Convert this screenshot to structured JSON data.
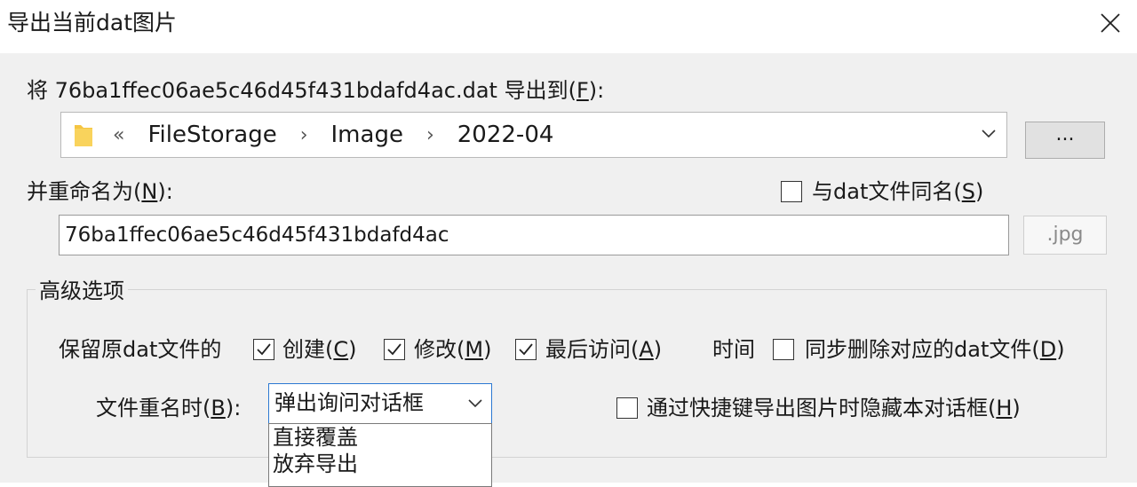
{
  "window": {
    "title": "导出当前dat图片"
  },
  "export": {
    "prefix": "将",
    "filename": "76ba1ffec06ae5c46d45f431bdafd4ac.dat",
    "suffix": "导出到(",
    "hotkey": "F",
    "suffix_end": "):"
  },
  "path": {
    "overflow": "«",
    "crumbs": [
      "FileStorage",
      "Image",
      "2022-04"
    ],
    "sep": "›"
  },
  "browse_label": "...",
  "rename": {
    "label": "并重命名为(",
    "hotkey": "N",
    "label_end": "):",
    "value": "76ba1ffec06ae5c46d45f431bdafd4ac",
    "extension": ".jpg",
    "same_name_label": "与dat文件同名(",
    "same_name_hotkey": "S",
    "same_name_end": ")"
  },
  "advanced": {
    "title": "高级选项",
    "keep_label": "保留原dat文件的",
    "created_label": "创建(",
    "created_hotkey": "C",
    "modified_label": "修改(",
    "modified_hotkey": "M",
    "accessed_label": "最后访问(",
    "accessed_hotkey": "A",
    "close_paren": ")",
    "time_label": "时间",
    "sync_delete_label": "同步删除对应的dat文件(",
    "sync_delete_hotkey": "D",
    "on_rename_label": "文件重名时(",
    "on_rename_hotkey": "B",
    "on_rename_end": "):",
    "on_rename_selected": "弹出询问对话框",
    "on_rename_options": [
      "直接覆盖",
      "放弃导出"
    ],
    "hide_dialog_label": "通过快捷键导出图片时隐藏本对话框(",
    "hide_dialog_hotkey": "H"
  },
  "checkboxes": {
    "same_name": false,
    "created": true,
    "modified": true,
    "accessed": true,
    "sync_delete": false,
    "hide_dialog": false
  },
  "colors": {
    "dialog_bg": "#f0f0f0",
    "focus_border": "#2b78d2",
    "folder": "#f5c542"
  }
}
